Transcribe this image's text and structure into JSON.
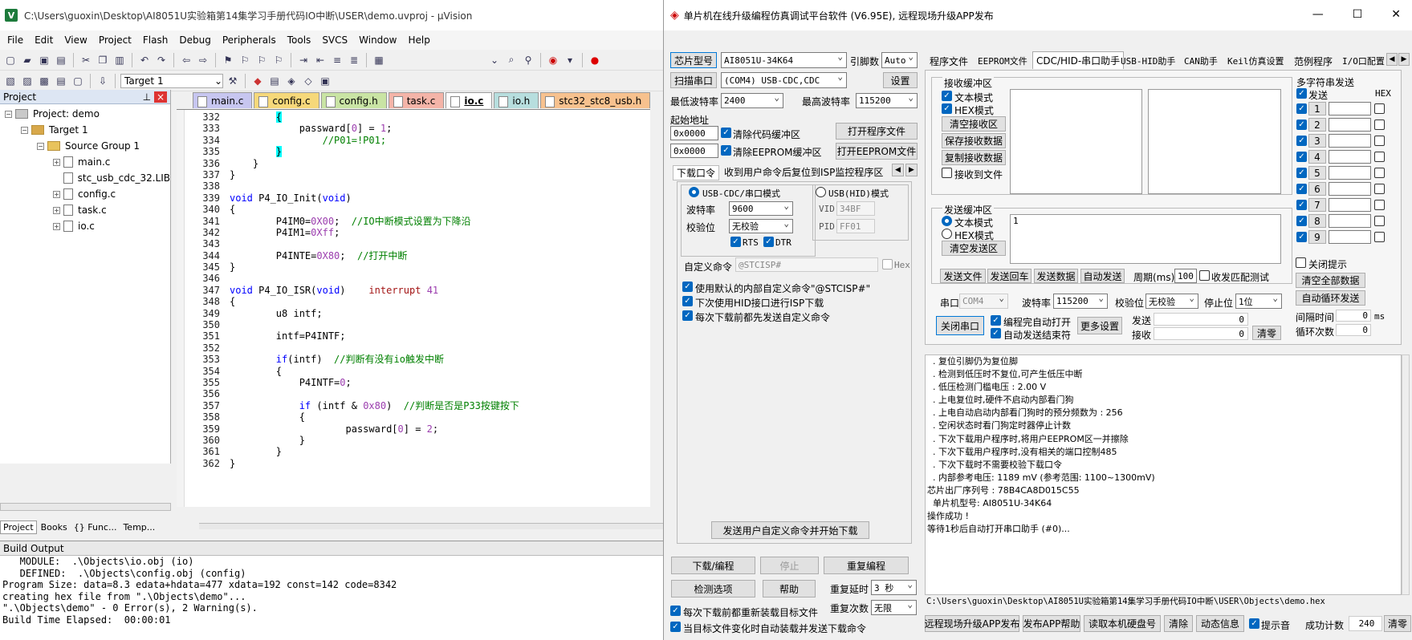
{
  "keil": {
    "title": "C:\\Users\\guoxin\\Desktop\\AI8051U实验箱第14集学习手册代码IO中断\\USER\\demo.uvproj - µVision",
    "menu": [
      "File",
      "Edit",
      "View",
      "Project",
      "Flash",
      "Debug",
      "Peripherals",
      "Tools",
      "SVCS",
      "Window",
      "Help"
    ],
    "target": "Target 1",
    "project_panel_title": "Project",
    "tree": {
      "project": "Project: demo",
      "target": "Target 1",
      "group": "Source Group 1",
      "files": [
        "main.c",
        "stc_usb_cdc_32.LIB",
        "config.c",
        "task.c",
        "io.c"
      ]
    },
    "bottom_tabs": [
      "Project",
      "Books",
      "{} Func...",
      "Temp..."
    ],
    "editor_tabs": [
      {
        "label": "main.c",
        "color": "#c7c6f0"
      },
      {
        "label": "config.c",
        "color": "#f6d87a"
      },
      {
        "label": "config.h",
        "color": "#c9e4a4"
      },
      {
        "label": "task.c",
        "color": "#f4b4a8"
      },
      {
        "label": "io.c",
        "color": "#ffffff"
      },
      {
        "label": "io.h",
        "color": "#b7dede"
      },
      {
        "label": "stc32_stc8_usb.h",
        "color": "#f7c18e"
      }
    ],
    "line_numbers": [
      "332",
      "333",
      "334",
      "335",
      "336",
      "337",
      "338",
      "339",
      "340",
      "341",
      "342",
      "343",
      "344",
      "345",
      "346",
      "347",
      "348",
      "349",
      "350",
      "351",
      "352",
      "353",
      "354",
      "355",
      "356",
      "357",
      "358",
      "359",
      "360",
      "361",
      "362"
    ],
    "code": {
      "l332a": "        ",
      "l332b": "{",
      "l333a": "            passward[",
      "l333n1": "0",
      "l333b": "] = ",
      "l333n2": "1",
      "l333c": ";",
      "l334": "                //P01=!P01;",
      "l335a": "        ",
      "l335b": "}",
      "l336": "    }",
      "l337": "}",
      "l338": "",
      "l339a": "void",
      "l339b": " P4_IO_Init(",
      "l339c": "void",
      "l339d": ")",
      "l340": "{",
      "l341a": "        P4IM0=",
      "l341n": "0X00",
      "l341b": ";  ",
      "l341c": "//IO中断模式设置为下降沿",
      "l342a": "        P4IM1=",
      "l342n": "0Xff",
      "l342b": ";",
      "l343": "",
      "l344a": "        P4INTE=",
      "l344n": "0X80",
      "l344b": ";  ",
      "l344c": "//打开中断",
      "l345": "}",
      "l346": "",
      "l347a": "void",
      "l347b": " P4_IO_ISR(",
      "l347c": "void",
      "l347d": ")    ",
      "l347e": "interrupt",
      "l347f": " ",
      "l347g": "41",
      "l348": "{",
      "l349": "        u8 intf;",
      "l350": "",
      "l351": "        intf=P4INTF;",
      "l352": "",
      "l353a": "        ",
      "l353b": "if",
      "l353c": "(intf)  ",
      "l353d": "//判断有没有io触发中断",
      "l354": "        {",
      "l355a": "            P4INTF=",
      "l355n": "0",
      "l355b": ";",
      "l356": "",
      "l357a": "            ",
      "l357b": "if",
      "l357c": " (intf & ",
      "l357n": "0x80",
      "l357d": ")  ",
      "l357e": "//判断是否是P33按键按下",
      "l358": "            {",
      "l359a": "                    passward[",
      "l359n1": "0",
      "l359b": "] = ",
      "l359n2": "2",
      "l359c": ";",
      "l360": "            }",
      "l361": "        }",
      "l362": "}"
    },
    "build_output_title": "Build Output",
    "build_output": [
      "   MODULE:  .\\Objects\\io.obj (io)",
      "   DEFINED:  .\\Objects\\config.obj (config)",
      "Program Size: data=8.3 edata+hdata=477 xdata=192 const=142 code=8342",
      "creating hex file from \".\\Objects\\demo\"...",
      "\".\\Objects\\demo\" - 0 Error(s), 2 Warning(s).",
      "Build Time Elapsed:  00:00:01"
    ]
  },
  "isp": {
    "title": "单片机在线升级编程仿真调试平台软件 (V6.95E), 远程现场升级APP发布",
    "chip_btn": "芯片型号",
    "chip": "AI8051U-34K64",
    "pin_label": "引脚数",
    "pin": "Auto",
    "scan_btn": "扫描串口",
    "port": "(COM4) USB-CDC,CDC",
    "settings_btn": "设置",
    "min_baud_label": "最低波特率",
    "min_baud": "2400",
    "max_baud_label": "最高波特率",
    "max_baud": "115200",
    "start_addr_label": "起始地址",
    "addr1": "0x0000",
    "clear_code": "清除代码缓冲区",
    "open_prog": "打开程序文件",
    "addr2": "0x0000",
    "clear_eeprom": "清除EEPROM缓冲区",
    "open_eeprom": "打开EEPROM文件",
    "sub_tab1": "下载口令",
    "sub_tab2": "收到用户命令后复位到ISP监控程序区",
    "usb_cdc_mode": "USB-CDC/串口模式",
    "usb_hid_mode": "USB(HID)模式",
    "baud_label": "波特率",
    "baud": "9600",
    "parity_label": "校验位",
    "parity": "无校验",
    "rts": "RTS",
    "dtr": "DTR",
    "vid_label": "VID",
    "vid": "34BF",
    "pid_label": "PID",
    "pid": "FF01",
    "custom_cmd_label": "自定义命令",
    "custom_cmd": "@STCISP#",
    "hex_label": "Hex",
    "opt1": "使用默认的内部自定义命令\"@STCISP#\"",
    "opt2": "下次使用HID接口进行ISP下载",
    "opt3": "每次下载前都先发送自定义命令",
    "send_custom_btn": "发送用户自定义命令并开始下载",
    "download_btn": "下载/编程",
    "stop_btn": "停止",
    "reprog_btn": "重复编程",
    "check_btn": "检测选项",
    "help_btn": "帮助",
    "delay_label": "重复延时",
    "delay": "3 秒",
    "count_label": "重复次数",
    "count": "无限",
    "reload_opt": "每次下载前都重新装载目标文件",
    "autoload_opt": "当目标文件变化时自动装载并发送下载命令",
    "tabs": [
      "程序文件",
      "EEPROM文件",
      "CDC/HID-串口助手",
      "USB-HID助手",
      "CAN助手",
      "Keil仿真设置",
      "范例程序",
      "I/O口配置"
    ],
    "recv_title": "接收缓冲区",
    "text_mode": "文本模式",
    "hex_mode": "HEX模式",
    "clear_recv": "清空接收区",
    "save_recv": "保存接收数据",
    "copy_recv": "复制接收数据",
    "recv_to_file": "接收到文件",
    "send_title": "发送缓冲区",
    "send_text_mode": "文本模式",
    "send_hex_mode": "HEX模式",
    "clear_send": "清空发送区",
    "send_content": "1",
    "send_file": "发送文件",
    "send_enter": "发送回车",
    "send_data": "发送数据",
    "auto_send": "自动发送",
    "period_label": "周期(ms)",
    "period": "100",
    "match_label": "收发匹配测试",
    "port_label": "串口",
    "com": "COM4",
    "baud2_label": "波特率",
    "baud2": "115200",
    "parity2_label": "校验位",
    "parity2": "无校验",
    "stop_label": "停止位",
    "stop": "1位",
    "close_port": "关闭串口",
    "auto_open": "编程完自动打开",
    "auto_end": "自动发送结束符",
    "more_settings": "更多设置",
    "send_count_label": "发送",
    "send_count": "0",
    "recv_count_label": "接收",
    "recv_count": "0",
    "clear_count": "清零",
    "multi_title": "多字符串发送",
    "multi_send_hdr": "发送",
    "multi_hex_hdr": "HEX",
    "multi_rows": [
      "1",
      "2",
      "3",
      "4",
      "5",
      "6",
      "7",
      "8",
      "9"
    ],
    "close_tip": "关闭提示",
    "clear_all": "清空全部数据",
    "auto_loop": "自动循环发送",
    "interval_label": "间隔时间",
    "interval": "0",
    "interval_unit": "ms",
    "loop_label": "循环次数",
    "loop": "0",
    "log": [
      "  . 复位引脚仍为复位脚",
      "  . 检测到低压时不复位,可产生低压中断",
      "  . 低压检测门槛电压 : 2.00 V",
      "  . 上电复位时,硬件不启动内部看门狗",
      "  . 上电自动启动内部看门狗时的预分频数为 : 256",
      "  . 空闲状态时看门狗定时器停止计数",
      "  . 下次下载用户程序时,将用户EEPROM区一并擦除",
      "  . 下次下载用户程序时,没有相关的端口控制485",
      "  . 下次下载时不需要校验下载口令",
      "  . 内部参考电压: 1189 mV (参考范围: 1100~1300mV)",
      "芯片出厂序列号 : 78B4CA8D015C55",
      "",
      "  单片机型号: AI8051U-34K64",
      "",
      "操作成功 !",
      "",
      "等待1秒后自动打开串口助手 (#0)..."
    ],
    "hex_path": "C:\\Users\\guoxin\\Desktop\\AI8051U实验箱第14集学习手册代码IO中断\\USER\\Objects\\demo.hex",
    "remote_app": "远程现场升级APP发布",
    "publish_help": "发布APP帮助",
    "read_disk": "读取本机硬盘号",
    "clear_btn": "清除",
    "anim_btn": "动态信息",
    "beep": "提示音",
    "success_label": "成功计数",
    "success": "240",
    "clear_zero": "清零"
  }
}
